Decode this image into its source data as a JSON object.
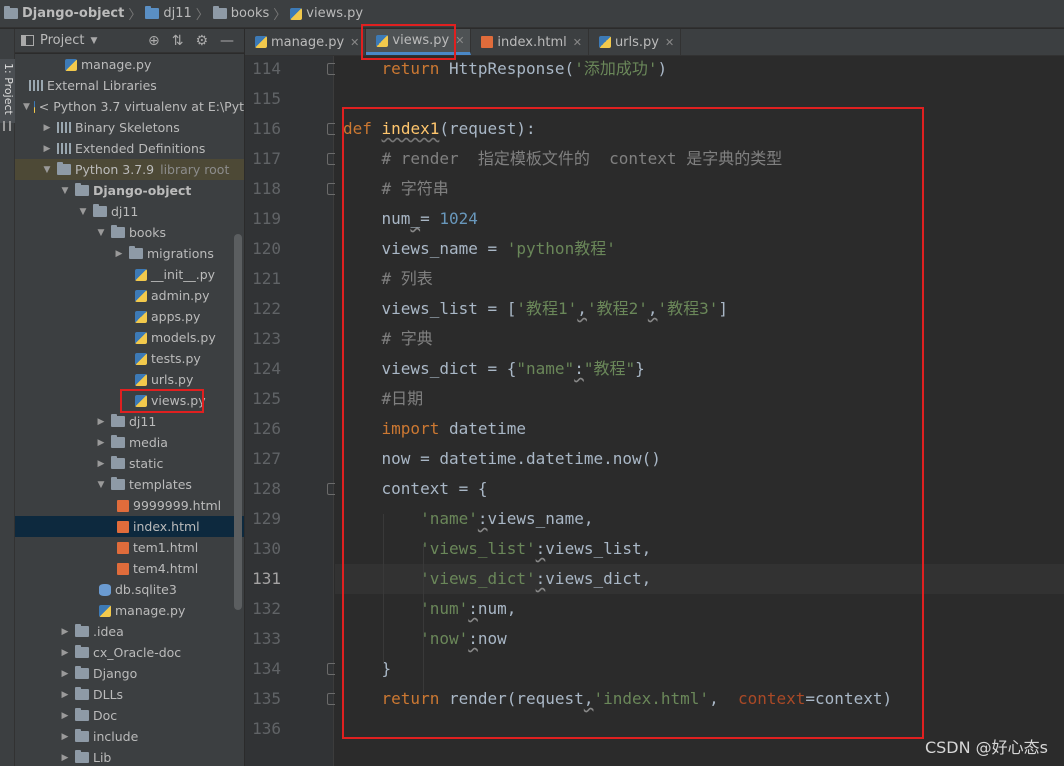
{
  "breadcrumb": [
    "Django-object",
    "dj11",
    "books",
    "views.py"
  ],
  "stripe": {
    "project_tab": "1: Project"
  },
  "project_panel": {
    "title": "Project",
    "rows": [
      {
        "label": "manage.py",
        "icon": "py"
      },
      {
        "label": "External Libraries",
        "icon": "lib"
      },
      {
        "label": "< Python 3.7 virtualenv at E:\\Pyt",
        "icon": "py"
      },
      {
        "label": "Binary Skeletons",
        "icon": "lib"
      },
      {
        "label": "Extended Definitions",
        "icon": "lib"
      },
      {
        "label": "Python 3.7.9",
        "extra": "library root",
        "icon": "folder"
      },
      {
        "label": "Django-object",
        "icon": "folder"
      },
      {
        "label": "dj11",
        "icon": "folder"
      },
      {
        "label": "books",
        "icon": "folder"
      },
      {
        "label": "migrations",
        "icon": "folder"
      },
      {
        "label": "__init__.py",
        "icon": "py"
      },
      {
        "label": "admin.py",
        "icon": "py"
      },
      {
        "label": "apps.py",
        "icon": "py"
      },
      {
        "label": "models.py",
        "icon": "py"
      },
      {
        "label": "tests.py",
        "icon": "py"
      },
      {
        "label": "urls.py",
        "icon": "py"
      },
      {
        "label": "views.py",
        "icon": "py"
      },
      {
        "label": "dj11",
        "icon": "folder"
      },
      {
        "label": "media",
        "icon": "folder"
      },
      {
        "label": "static",
        "icon": "folder"
      },
      {
        "label": "templates",
        "icon": "folder"
      },
      {
        "label": "9999999.html",
        "icon": "html"
      },
      {
        "label": "index.html",
        "icon": "html"
      },
      {
        "label": "tem1.html",
        "icon": "html"
      },
      {
        "label": "tem4.html",
        "icon": "html"
      },
      {
        "label": "db.sqlite3",
        "icon": "db"
      },
      {
        "label": "manage.py",
        "icon": "py"
      },
      {
        "label": ".idea",
        "icon": "folder"
      },
      {
        "label": "cx_Oracle-doc",
        "icon": "folder"
      },
      {
        "label": "Django",
        "icon": "folder"
      },
      {
        "label": "DLLs",
        "icon": "folder"
      },
      {
        "label": "Doc",
        "icon": "folder"
      },
      {
        "label": "include",
        "icon": "folder"
      },
      {
        "label": "Lib",
        "icon": "folder"
      }
    ]
  },
  "tabs": [
    {
      "label": "manage.py",
      "icon": "py",
      "active": false
    },
    {
      "label": "views.py",
      "icon": "py",
      "active": true
    },
    {
      "label": "index.html",
      "icon": "html",
      "active": false
    },
    {
      "label": "urls.py",
      "icon": "py",
      "active": false
    }
  ],
  "editor": {
    "current_line": "131",
    "lines": [
      {
        "n": "114",
        "tokens": [
          [
            "    ",
            ""
          ],
          [
            "return",
            "kw"
          ],
          [
            " HttpResponse(",
            ""
          ],
          [
            "'添加成功'",
            "str"
          ],
          [
            ")",
            ""
          ]
        ]
      },
      {
        "n": "115",
        "tokens": []
      },
      {
        "n": "116",
        "tokens": [
          [
            "def",
            "kw"
          ],
          [
            " ",
            ""
          ],
          [
            "index1",
            "fn"
          ],
          [
            "(request):",
            ""
          ]
        ]
      },
      {
        "n": "117",
        "tokens": [
          [
            "    ",
            ""
          ],
          [
            "# render  指定模板文件的  context 是字典的类型",
            "cmt"
          ]
        ]
      },
      {
        "n": "118",
        "tokens": [
          [
            "    ",
            ""
          ],
          [
            "# 字符串",
            "cmt"
          ]
        ]
      },
      {
        "n": "119",
        "tokens": [
          [
            "    num",
            ""
          ],
          [
            "_",
            "wavy"
          ],
          [
            "= ",
            ""
          ],
          [
            "1024",
            "num"
          ]
        ]
      },
      {
        "n": "120",
        "tokens": [
          [
            "    views_name = ",
            ""
          ],
          [
            "'python教程'",
            "str"
          ]
        ]
      },
      {
        "n": "121",
        "tokens": [
          [
            "    ",
            ""
          ],
          [
            "# 列表",
            "cmt"
          ]
        ]
      },
      {
        "n": "122",
        "tokens": [
          [
            "    views_list = [",
            ""
          ],
          [
            "'教程1'",
            "str"
          ],
          [
            ",",
            "wavy"
          ],
          [
            "'教程2'",
            "str"
          ],
          [
            ",",
            "wavy"
          ],
          [
            "'教程3'",
            "str"
          ],
          [
            "]",
            ""
          ]
        ]
      },
      {
        "n": "123",
        "tokens": [
          [
            "    ",
            ""
          ],
          [
            "# 字典",
            "cmt"
          ]
        ]
      },
      {
        "n": "124",
        "tokens": [
          [
            "    views_dict = {",
            ""
          ],
          [
            "\"name\"",
            "str"
          ],
          [
            ":",
            "wavy"
          ],
          [
            "\"教程\"",
            "str"
          ],
          [
            "}",
            ""
          ]
        ]
      },
      {
        "n": "125",
        "tokens": [
          [
            "    ",
            ""
          ],
          [
            "#日期",
            "cmt"
          ]
        ]
      },
      {
        "n": "126",
        "tokens": [
          [
            "    ",
            ""
          ],
          [
            "import",
            "kw"
          ],
          [
            " datetime",
            ""
          ]
        ]
      },
      {
        "n": "127",
        "tokens": [
          [
            "    now = datetime.datetime.now()",
            ""
          ]
        ]
      },
      {
        "n": "128",
        "tokens": [
          [
            "    context = {",
            ""
          ]
        ]
      },
      {
        "n": "129",
        "tokens": [
          [
            "        ",
            ""
          ],
          [
            "'name'",
            "str"
          ],
          [
            ":",
            "wavy"
          ],
          [
            "views_name,",
            ""
          ]
        ]
      },
      {
        "n": "130",
        "tokens": [
          [
            "        ",
            ""
          ],
          [
            "'views_list'",
            "str"
          ],
          [
            ":",
            "wavy"
          ],
          [
            "views_list,",
            ""
          ]
        ]
      },
      {
        "n": "131",
        "tokens": [
          [
            "        ",
            ""
          ],
          [
            "'views_dict'",
            "str"
          ],
          [
            ":",
            "wavy"
          ],
          [
            "views_dict,",
            ""
          ]
        ]
      },
      {
        "n": "132",
        "tokens": [
          [
            "        ",
            ""
          ],
          [
            "'num'",
            "str"
          ],
          [
            ":",
            "wavy"
          ],
          [
            "num,",
            ""
          ]
        ]
      },
      {
        "n": "133",
        "tokens": [
          [
            "        ",
            ""
          ],
          [
            "'now'",
            "str"
          ],
          [
            ":",
            "wavy"
          ],
          [
            "now",
            ""
          ]
        ]
      },
      {
        "n": "134",
        "tokens": [
          [
            "    }",
            ""
          ]
        ]
      },
      {
        "n": "135",
        "tokens": [
          [
            "    ",
            ""
          ],
          [
            "return",
            "kw"
          ],
          [
            " render(request",
            ""
          ],
          [
            ",",
            "wavy"
          ],
          [
            "'index.html'",
            "str"
          ],
          [
            ",  ",
            ""
          ],
          [
            "context",
            "param"
          ],
          [
            "=context)",
            ""
          ]
        ]
      },
      {
        "n": "136",
        "tokens": []
      }
    ]
  },
  "watermark": "CSDN @好心态s",
  "colors": {
    "keyword": "#cc7832",
    "string": "#6a8759",
    "number": "#6897bb",
    "comment": "#808080",
    "function": "#ffc66d",
    "highlight_box": "#e02020"
  }
}
